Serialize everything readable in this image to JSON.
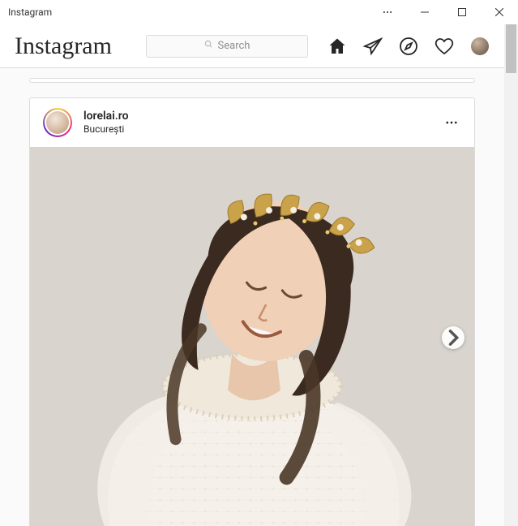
{
  "window": {
    "title": "Instagram"
  },
  "nav": {
    "brand": "Instagram",
    "search_placeholder": "Search"
  },
  "post": {
    "username": "lorelai.ro",
    "location": "București"
  }
}
